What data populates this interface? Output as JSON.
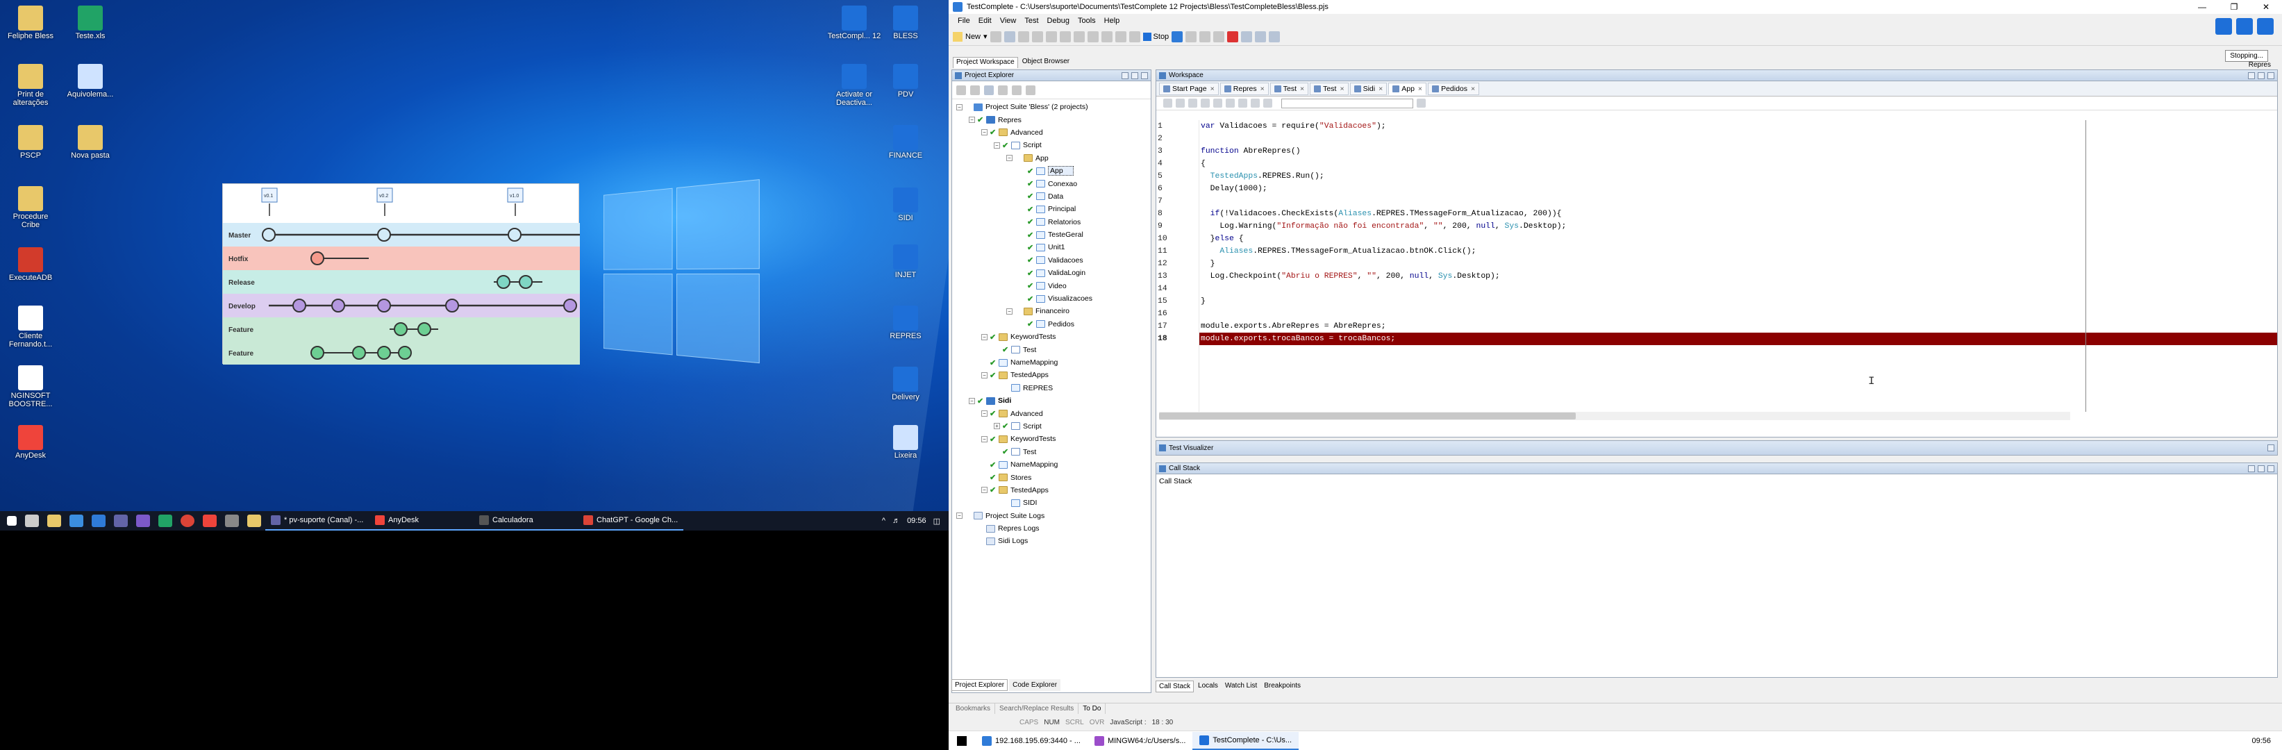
{
  "desktop": {
    "icons_left": [
      {
        "label": "Feliphe Bless",
        "color": "#e8c86a"
      },
      {
        "label": "Teste.xls",
        "color": "#21a366"
      },
      {
        "label": "Print de alterações",
        "color": "#e8c86a"
      },
      {
        "label": "Aquivolema...",
        "color": "#cfe3ff"
      },
      {
        "label": "PSCP",
        "color": "#e8c86a"
      },
      {
        "label": "Nova pasta",
        "color": "#e8c86a"
      },
      {
        "label": "Procedure Cribe",
        "color": "#e8c86a"
      },
      {
        "label": "ExecuteADB",
        "color": "#d23b2b"
      },
      {
        "label": "Cliente Fernando.t...",
        "color": "#ffffff"
      },
      {
        "label": "NGINSOFT BOOSTRE...",
        "color": "#ffffff"
      },
      {
        "label": "AnyDesk",
        "color": "#ef443b"
      }
    ],
    "icons_right": [
      {
        "label": "TestCompl... 12",
        "color": "#1e6fd8"
      },
      {
        "label": "BLESS",
        "color": "#1e6fd8"
      },
      {
        "label": "Activate or Deactiva...",
        "color": "#1e6fd8"
      },
      {
        "label": "PDV",
        "color": "#1e6fd8"
      },
      {
        "label": "FINANCE",
        "color": "#1e6fd8"
      },
      {
        "label": "SIDI",
        "color": "#1e6fd8"
      },
      {
        "label": "INJET",
        "color": "#1e6fd8"
      },
      {
        "label": "REPRES",
        "color": "#1e6fd8"
      },
      {
        "label": "Delivery",
        "color": "#1e6fd8"
      },
      {
        "label": "Lixeira",
        "color": "#cfe3ff"
      }
    ],
    "gitflow": {
      "rows": [
        "Master",
        "Hotfix",
        "Release",
        "Develop",
        "Feature",
        "Feature"
      ],
      "row_colors": [
        "#d3ebf8",
        "#f8c4bc",
        "#c7ede6",
        "#dccdf0",
        "#c9e9d6",
        "#c9e9d6"
      ],
      "tags": [
        "v0.1",
        "v0.2",
        "v1.0"
      ]
    }
  },
  "taskbar_left": {
    "tasks": [
      {
        "label": "* pv-suporte (Canal) -...",
        "color": "#6264a7"
      },
      {
        "label": "AnyDesk",
        "color": "#ef443b"
      },
      {
        "label": "Calculadora",
        "color": "#555555"
      },
      {
        "label": "ChatGPT - Google Ch...",
        "color": "#db4437"
      }
    ],
    "time": "09:56"
  },
  "app": {
    "title": "TestComplete - C:\\Users\\suporte\\Documents\\TestComplete 12 Projects\\Bless\\TestCompleteBless\\Bless.pjs",
    "menu": [
      "File",
      "Edit",
      "View",
      "Test",
      "Debug",
      "Tools",
      "Help"
    ],
    "toolbar": {
      "new_label": "New",
      "stop_label": "Stop"
    },
    "stopping_popup": "Stopping...",
    "repres_popup": "Repres",
    "workspace_tabs": [
      "Project Workspace",
      "Object Browser"
    ],
    "project_explorer": {
      "title": "Project Explorer",
      "tree": [
        {
          "label": "Project Suite 'Bless' (2 projects)",
          "indent": 0,
          "exp": "-",
          "chk": false,
          "icon": "suite"
        },
        {
          "label": "Repres",
          "indent": 1,
          "exp": "-",
          "chk": true,
          "icon": "proj"
        },
        {
          "label": "Advanced",
          "indent": 2,
          "exp": "-",
          "chk": true,
          "icon": "folder"
        },
        {
          "label": "Script",
          "indent": 3,
          "exp": "-",
          "chk": true,
          "icon": "script"
        },
        {
          "label": "App",
          "indent": 4,
          "exp": "-",
          "chk": false,
          "icon": "folder"
        },
        {
          "label": "App",
          "indent": 5,
          "exp": "",
          "chk": true,
          "icon": "unit",
          "sel": true
        },
        {
          "label": "Conexao",
          "indent": 5,
          "exp": "",
          "chk": true,
          "icon": "unit"
        },
        {
          "label": "Data",
          "indent": 5,
          "exp": "",
          "chk": true,
          "icon": "unit"
        },
        {
          "label": "Principal",
          "indent": 5,
          "exp": "",
          "chk": true,
          "icon": "unit"
        },
        {
          "label": "Relatorios",
          "indent": 5,
          "exp": "",
          "chk": true,
          "icon": "unit"
        },
        {
          "label": "TesteGeral",
          "indent": 5,
          "exp": "",
          "chk": true,
          "icon": "unit"
        },
        {
          "label": "Unit1",
          "indent": 5,
          "exp": "",
          "chk": true,
          "icon": "unit"
        },
        {
          "label": "Validacoes",
          "indent": 5,
          "exp": "",
          "chk": true,
          "icon": "unit"
        },
        {
          "label": "ValidaLogin",
          "indent": 5,
          "exp": "",
          "chk": true,
          "icon": "unit"
        },
        {
          "label": "Video",
          "indent": 5,
          "exp": "",
          "chk": true,
          "icon": "unit"
        },
        {
          "label": "Visualizacoes",
          "indent": 5,
          "exp": "",
          "chk": true,
          "icon": "unit"
        },
        {
          "label": "Financeiro",
          "indent": 4,
          "exp": "-",
          "chk": false,
          "icon": "folder"
        },
        {
          "label": "Pedidos",
          "indent": 5,
          "exp": "",
          "chk": true,
          "icon": "unit"
        },
        {
          "label": "KeywordTests",
          "indent": 2,
          "exp": "-",
          "chk": true,
          "icon": "folder"
        },
        {
          "label": "Test",
          "indent": 3,
          "exp": "",
          "chk": true,
          "icon": "script"
        },
        {
          "label": "NameMapping",
          "indent": 2,
          "exp": "",
          "chk": true,
          "icon": "unit"
        },
        {
          "label": "TestedApps",
          "indent": 2,
          "exp": "-",
          "chk": true,
          "icon": "folder"
        },
        {
          "label": "REPRES",
          "indent": 3,
          "exp": "",
          "chk": false,
          "icon": "unit"
        },
        {
          "label": "Sidi",
          "indent": 1,
          "exp": "-",
          "chk": true,
          "icon": "proj",
          "bold": true
        },
        {
          "label": "Advanced",
          "indent": 2,
          "exp": "-",
          "chk": true,
          "icon": "folder"
        },
        {
          "label": "Script",
          "indent": 3,
          "exp": "+",
          "chk": true,
          "icon": "script"
        },
        {
          "label": "KeywordTests",
          "indent": 2,
          "exp": "-",
          "chk": true,
          "icon": "folder"
        },
        {
          "label": "Test",
          "indent": 3,
          "exp": "",
          "chk": true,
          "icon": "script"
        },
        {
          "label": "NameMapping",
          "indent": 2,
          "exp": "",
          "chk": true,
          "icon": "unit"
        },
        {
          "label": "Stores",
          "indent": 2,
          "exp": "",
          "chk": true,
          "icon": "folder"
        },
        {
          "label": "TestedApps",
          "indent": 2,
          "exp": "-",
          "chk": true,
          "icon": "folder"
        },
        {
          "label": "SIDI",
          "indent": 3,
          "exp": "",
          "chk": false,
          "icon": "unit"
        },
        {
          "label": "Project Suite Logs",
          "indent": 0,
          "exp": "-",
          "chk": false,
          "icon": "log"
        },
        {
          "label": "Repres Logs",
          "indent": 1,
          "exp": "",
          "chk": false,
          "icon": "log"
        },
        {
          "label": "Sidi Logs",
          "indent": 1,
          "exp": "",
          "chk": false,
          "icon": "log"
        }
      ],
      "bottom_tabs": [
        "Project Explorer",
        "Code Explorer"
      ]
    },
    "workspace": {
      "title": "Workspace",
      "tabs": [
        "Start Page",
        "Repres",
        "Test",
        "Test",
        "Sidi",
        "App",
        "Pedidos"
      ],
      "active_tab": 5,
      "lines": [
        {
          "n": "1",
          "code": "var Validacoes = require(\"Validacoes\");"
        },
        {
          "n": "2",
          "code": ""
        },
        {
          "n": "3",
          "code": "function AbreRepres()"
        },
        {
          "n": "4",
          "code": "{"
        },
        {
          "n": "5",
          "code": "  TestedApps.REPRES.Run();"
        },
        {
          "n": "6",
          "code": "  Delay(1000);"
        },
        {
          "n": "7",
          "code": ""
        },
        {
          "n": "8",
          "code": "  if(!Validacoes.CheckExists(Aliases.REPRES.TMessageForm_Atualizacao, 200)){"
        },
        {
          "n": "9",
          "code": "    Log.Warning(\"Informação não foi encontrada\", \"\", 200, null, Sys.Desktop);"
        },
        {
          "n": "10",
          "code": "  }else {"
        },
        {
          "n": "11",
          "code": "    Aliases.REPRES.TMessageForm_Atualizacao.btnOK.Click();"
        },
        {
          "n": "12",
          "code": "  }"
        },
        {
          "n": "13",
          "code": "  Log.Checkpoint(\"Abriu o REPRES\", \"\", 200, null, Sys.Desktop);"
        },
        {
          "n": "14",
          "code": ""
        },
        {
          "n": "15",
          "code": "}"
        },
        {
          "n": "16",
          "code": ""
        },
        {
          "n": "17",
          "code": "module.exports.AbreRepres = AbreRepres;"
        },
        {
          "n": "18",
          "code": "module.exports.trocaBancos = trocaBancos;",
          "highlight": true
        }
      ]
    },
    "visualizer_title": "Test Visualizer",
    "callstack": {
      "title": "Call Stack",
      "body": "Call Stack"
    },
    "callstack_tabs": [
      "Call Stack",
      "Locals",
      "Watch List",
      "Breakpoints"
    ],
    "bottom_tabs": [
      "Bookmarks",
      "Search/Replace Results",
      "To Do"
    ],
    "status": {
      "caps": "CAPS",
      "num": "NUM",
      "scrl": "SCRL",
      "ovr": "OVR",
      "lang": "JavaScript :",
      "pos": "18 :  30"
    }
  },
  "taskbar_right": {
    "tasks": [
      {
        "label": "192.168.195.69:3440 - ...",
        "color": "#2f7bd8"
      },
      {
        "label": "MINGW64:/c/Users/s...",
        "color": "#9b4dca"
      },
      {
        "label": "TestComplete - C:\\Us...",
        "color": "#1e6fd8",
        "active": true
      }
    ],
    "time": "09:56"
  }
}
